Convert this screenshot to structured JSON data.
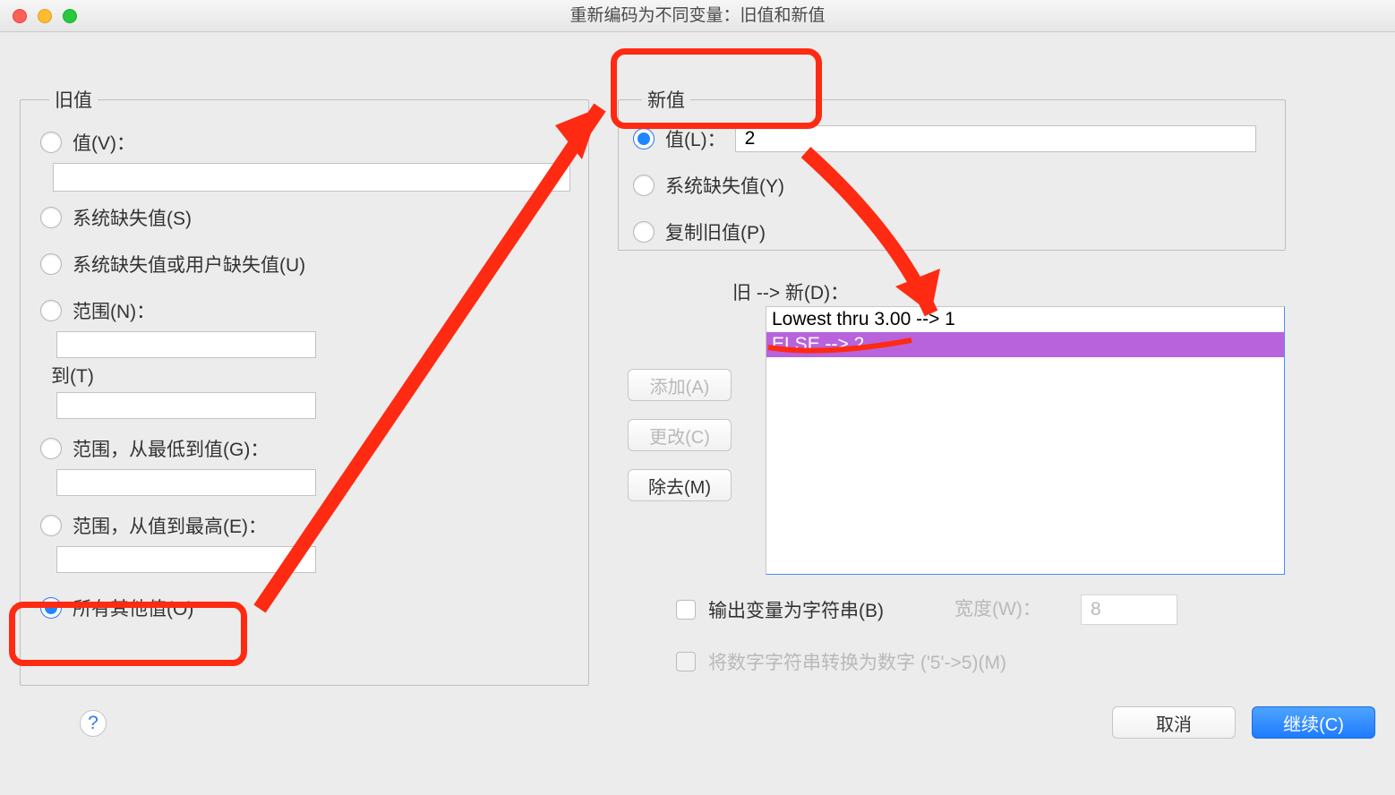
{
  "window": {
    "title": "重新编码为不同变量：旧值和新值"
  },
  "oldValues": {
    "legend": "旧值",
    "valueLabel": "值(V)：",
    "valueInput": "",
    "sysmisLabel": "系统缺失值(S)",
    "sysOrUserMisLabel": "系统缺失值或用户缺失值(U)",
    "rangeLabel": "范围(N)：",
    "rangeFrom": "",
    "toLabel": "到(T)",
    "rangeTo": "",
    "rangeLowestLabel": "范围，从最低到值(G)：",
    "rangeLowestInput": "",
    "rangeHighestLabel": "范围，从值到最高(E)：",
    "rangeHighestInput": "",
    "allOtherLabel": "所有其他值(O)",
    "selected": "allOther"
  },
  "newValues": {
    "legend": "新值",
    "valueLabel": "值(L)：",
    "valueInput": "2",
    "sysmisLabel": "系统缺失值(Y)",
    "copyOldLabel": "复制旧值(P)",
    "selected": "value"
  },
  "mapping": {
    "label": "旧 --> 新(D)：",
    "rows": [
      {
        "text": "Lowest thru 3.00 --> 1",
        "selected": false
      },
      {
        "text": "ELSE --> 2",
        "selected": true
      }
    ]
  },
  "sideButtons": {
    "add": "添加(A)",
    "change": "更改(C)",
    "remove": "除去(M)"
  },
  "outputString": {
    "checkboxLabel": "输出变量为字符串(B)",
    "widthLabel": "宽度(W)：",
    "widthValue": "8"
  },
  "convertNumeric": {
    "label": "将数字字符串转换为数字 ('5'->5)(M)"
  },
  "help": "?",
  "bottom": {
    "cancel": "取消",
    "continue": "继续(C)"
  }
}
